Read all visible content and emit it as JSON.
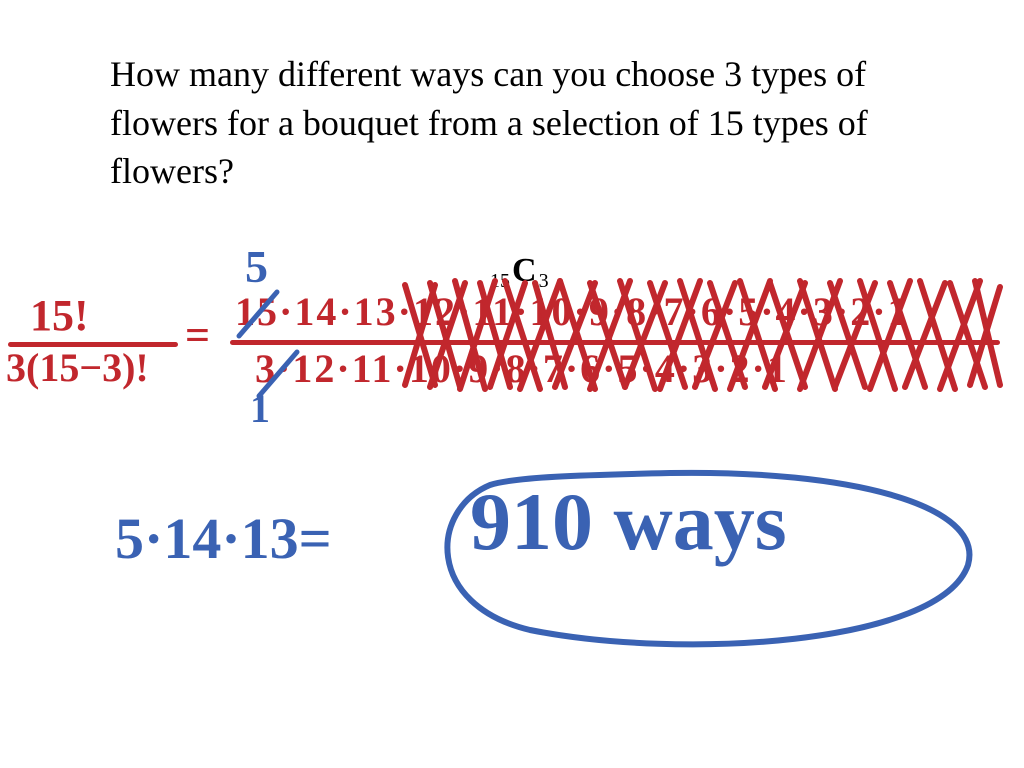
{
  "question": "How many different ways can you choose 3 types of flowers for a bouquet from a selection of 15 types of flowers?",
  "notation": {
    "n": "15",
    "sym": "C",
    "r": "3"
  },
  "formula": {
    "left_num": "15!",
    "left_den": "3(15−3)!",
    "equals": "=",
    "right_num": "15·14·13·12·11·10·9·8·7·6·5·4·3·2·1",
    "right_den": "3·12·11·10·9·8·7·6·5·4·3·2·1"
  },
  "simplify": {
    "top": "5",
    "bottom": "1"
  },
  "final": {
    "expr": "5·14·13=",
    "answer": "910 ways"
  },
  "colors": {
    "red": "#c1272d",
    "blue": "#3a62b3"
  }
}
